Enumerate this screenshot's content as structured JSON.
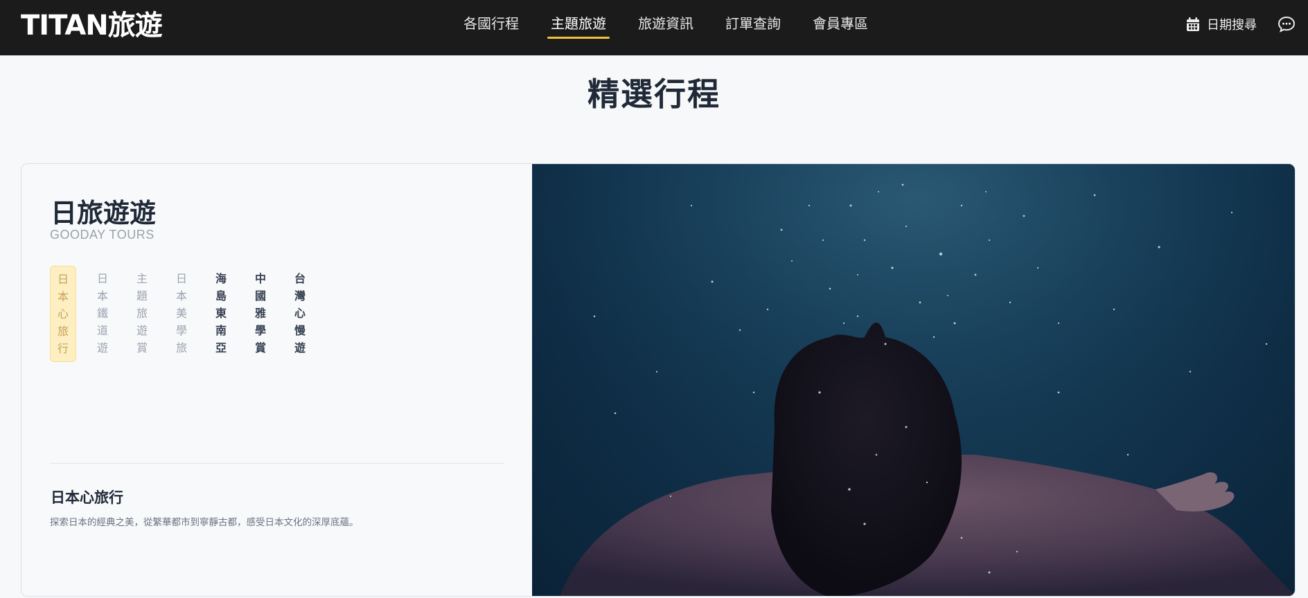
{
  "header": {
    "brand": "TITAN旅遊",
    "nav": [
      "各國行程",
      "主題旅遊",
      "旅遊資訊",
      "訂單查詢",
      "會員專區"
    ],
    "active_nav": "主題旅遊",
    "date_search_label": "日期搜尋",
    "accent_color": "#f2c23a"
  },
  "main": {
    "section_title": "精選行程",
    "card": {
      "title": "日旅遊遊",
      "subtitle": "GOODAY TOURS",
      "tags": [
        "日本心旅行",
        "日本鐵道遊",
        "主題旅遊賞",
        "日本美學旅",
        "海島東南亞",
        "中國雅學賞",
        "台灣心慢遊"
      ],
      "active_tag": "日本心旅行",
      "feature_title": "日本心旅行",
      "feature_description": "探索日本的經典之美，從繁華都市到寧靜古都，感受日本文化的深厚底蘊。",
      "image_alt": "underwater swimmer"
    }
  }
}
